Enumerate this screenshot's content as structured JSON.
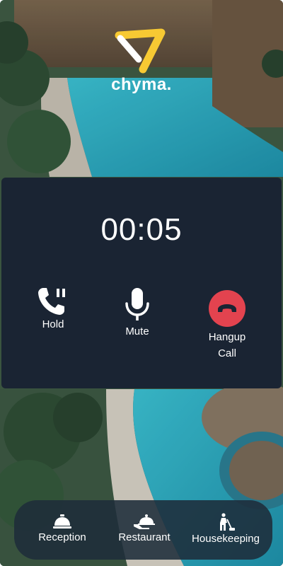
{
  "brand": {
    "name": "chyma.",
    "logo_color": "#f7c933"
  },
  "call": {
    "timer": "00:05",
    "controls": {
      "hold": {
        "label": "Hold",
        "icon": "phone-pause-icon"
      },
      "mute": {
        "label": "Mute",
        "icon": "microphone-icon"
      },
      "hangup": {
        "label_line1": "Hangup",
        "label_line2": "Call",
        "icon": "phone-hangup-icon",
        "color": "#e3434f"
      }
    }
  },
  "nav": {
    "items": [
      {
        "label": "Reception",
        "icon": "service-bell-icon"
      },
      {
        "label": "Restaurant",
        "icon": "food-cloche-icon"
      },
      {
        "label": "Housekeeping",
        "icon": "cleaner-icon"
      }
    ]
  },
  "colors": {
    "card": "#1a2433",
    "nav": "#1e2c3a",
    "pool": "#36b5c9"
  }
}
